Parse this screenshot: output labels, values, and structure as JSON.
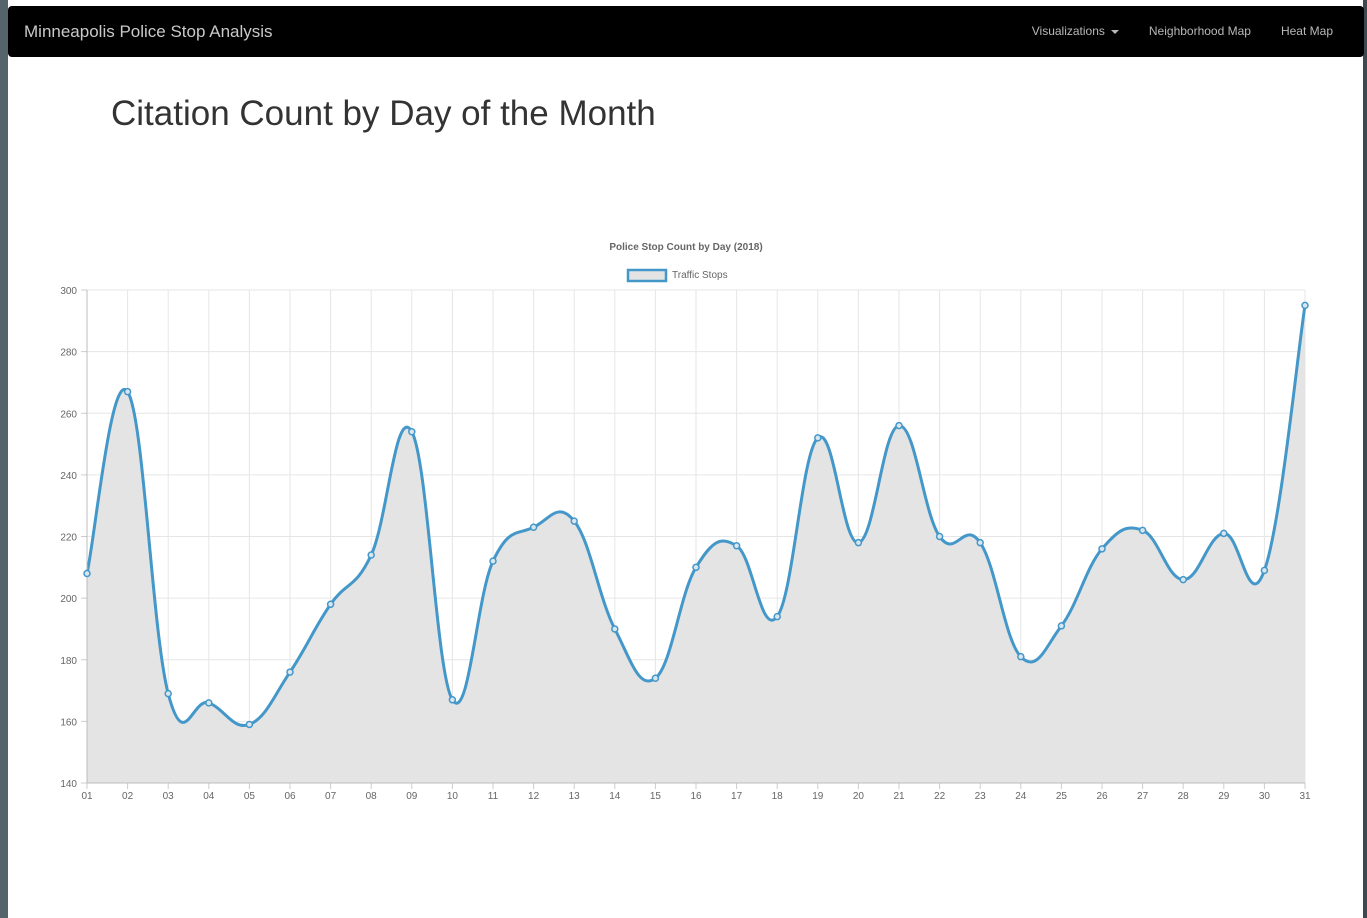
{
  "navbar": {
    "brand": "Minneapolis Police Stop Analysis",
    "links": [
      {
        "label": "Visualizations",
        "dropdown": true
      },
      {
        "label": "Neighborhood Map",
        "dropdown": false
      },
      {
        "label": "Heat Map",
        "dropdown": false
      }
    ]
  },
  "main": {
    "title": "Citation Count by Day of the Month"
  },
  "colors": {
    "line": "#4497c9",
    "fill": "#e4e4e4",
    "grid": "#e6e6e6",
    "navbar": "#000000"
  },
  "chart_data": {
    "type": "area",
    "title": "Police Stop Count by Day (2018)",
    "xlabel": "",
    "ylabel": "",
    "ylim": [
      140,
      300
    ],
    "yticks": [
      140,
      160,
      180,
      200,
      220,
      240,
      260,
      280,
      300
    ],
    "grid": true,
    "legend_position": "top",
    "categories": [
      "01",
      "02",
      "03",
      "04",
      "05",
      "06",
      "07",
      "08",
      "09",
      "10",
      "11",
      "12",
      "13",
      "14",
      "15",
      "16",
      "17",
      "18",
      "19",
      "20",
      "21",
      "22",
      "23",
      "24",
      "25",
      "26",
      "27",
      "28",
      "29",
      "30",
      "31"
    ],
    "series": [
      {
        "name": "Traffic Stops",
        "values": [
          208,
          267,
          169,
          166,
          159,
          176,
          198,
          214,
          254,
          167,
          212,
          223,
          225,
          190,
          174,
          210,
          217,
          194,
          252,
          218,
          256,
          220,
          218,
          181,
          191,
          216,
          222,
          206,
          221,
          209,
          295
        ]
      }
    ]
  }
}
